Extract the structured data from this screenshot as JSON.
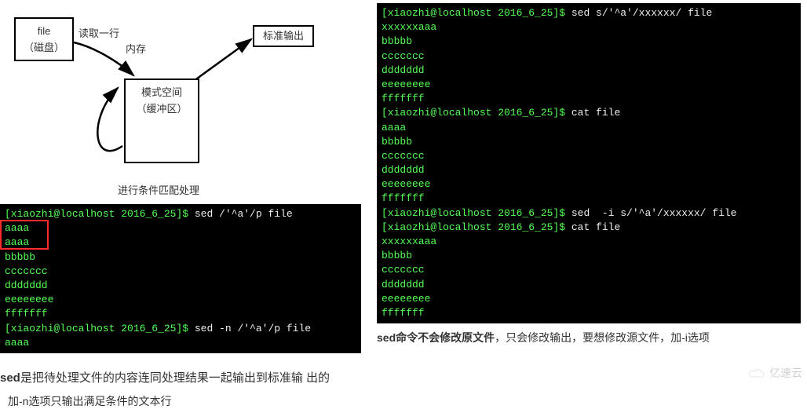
{
  "diagram": {
    "file_box_line1": "file",
    "file_box_line2": "（磁盘）",
    "read_label": "读取一行",
    "mem_label": "内存",
    "pattern_box_line1": "模式空间",
    "pattern_box_line2": "（缓冲区）",
    "out_box": "标准输出",
    "match_label": "进行条件匹配处理"
  },
  "left_term": {
    "prompt1_user": "[xiaozhi@localhost 2016_6_25]$ ",
    "cmd1": "sed /'^a'/p file",
    "out1": "aaaa",
    "out2": "aaaa",
    "out3": "bbbbb",
    "out4": "ccccccc",
    "out5": "ddddddd",
    "out6": "eeeeeeee",
    "out7": "fffffff",
    "prompt2_user": "[xiaozhi@localhost 2016_6_25]$ ",
    "cmd2": "sed -n /'^a'/p file",
    "out8": "aaaa"
  },
  "right_term": {
    "prompt1": "[xiaozhi@localhost 2016_6_25]$ ",
    "cmd1": "sed s/'^a'/xxxxxx/ file",
    "o1": "xxxxxxaaa",
    "o2": "bbbbb",
    "o3": "ccccccc",
    "o4": "ddddddd",
    "o5": "eeeeeeee",
    "o6": "fffffff",
    "prompt2": "[xiaozhi@localhost 2016_6_25]$ ",
    "cmd2": "cat file",
    "o7": "aaaa",
    "o8": "bbbbb",
    "o9": "ccccccc",
    "o10": "ddddddd",
    "o11": "eeeeeeee",
    "o12": "fffffff",
    "prompt3": "[xiaozhi@localhost 2016_6_25]$ ",
    "cmd3": "sed  -i s/'^a'/xxxxxx/ file",
    "prompt4": "[xiaozhi@localhost 2016_6_25]$ ",
    "cmd4": "cat file",
    "o13": "xxxxxxaaa",
    "o14": "bbbbb",
    "o15": "ccccccc",
    "o16": "ddddddd",
    "o17": "eeeeeeee",
    "o18": "fffffff"
  },
  "captions": {
    "left1_bold": "sed",
    "left1_rest": "是把待处理文件的内容连同处理结果一起输出到标准输 出的",
    "left2": "加-n选项只输出满足条件的文本行",
    "right_bold": "sed命令不会修改原文件",
    "right_rest": "，只会修改输出，要想修改源文件，加-i选项"
  },
  "watermark": {
    "text": "亿速云"
  }
}
